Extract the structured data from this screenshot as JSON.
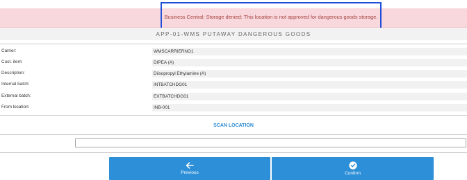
{
  "alert": {
    "message": "Business Central: Storage denied: This location is not approved for dangerous goods storage."
  },
  "header": {
    "title": "APP-01-WMS PUTAWAY DANGEROUS GOODS"
  },
  "details": [
    {
      "label": "Carrier:",
      "value": "WMSCARRIERNO1"
    },
    {
      "label": "Cust. item:",
      "value": "DIPEA (A)"
    },
    {
      "label": "Description:",
      "value": "Diisopropyl Ethylamine (A)"
    },
    {
      "label": "Internal batch:",
      "value": "INTBATCHDG01"
    },
    {
      "label": "External batch:",
      "value": "EXTBATCHDG01"
    },
    {
      "label": "From location:",
      "value": "INB-001"
    }
  ],
  "scan": {
    "label": "SCAN LOCATION",
    "value": ""
  },
  "buttons": {
    "previous": "Previous",
    "confirm": "Confirm"
  },
  "icons": {
    "previous": "arrow-left-icon",
    "confirm": "check-circle-icon"
  },
  "colors": {
    "alert_bg": "#f8d8dc",
    "alert_text": "#a5413f",
    "highlight_border": "#1f4fd8",
    "accent": "#2c8fd7"
  }
}
